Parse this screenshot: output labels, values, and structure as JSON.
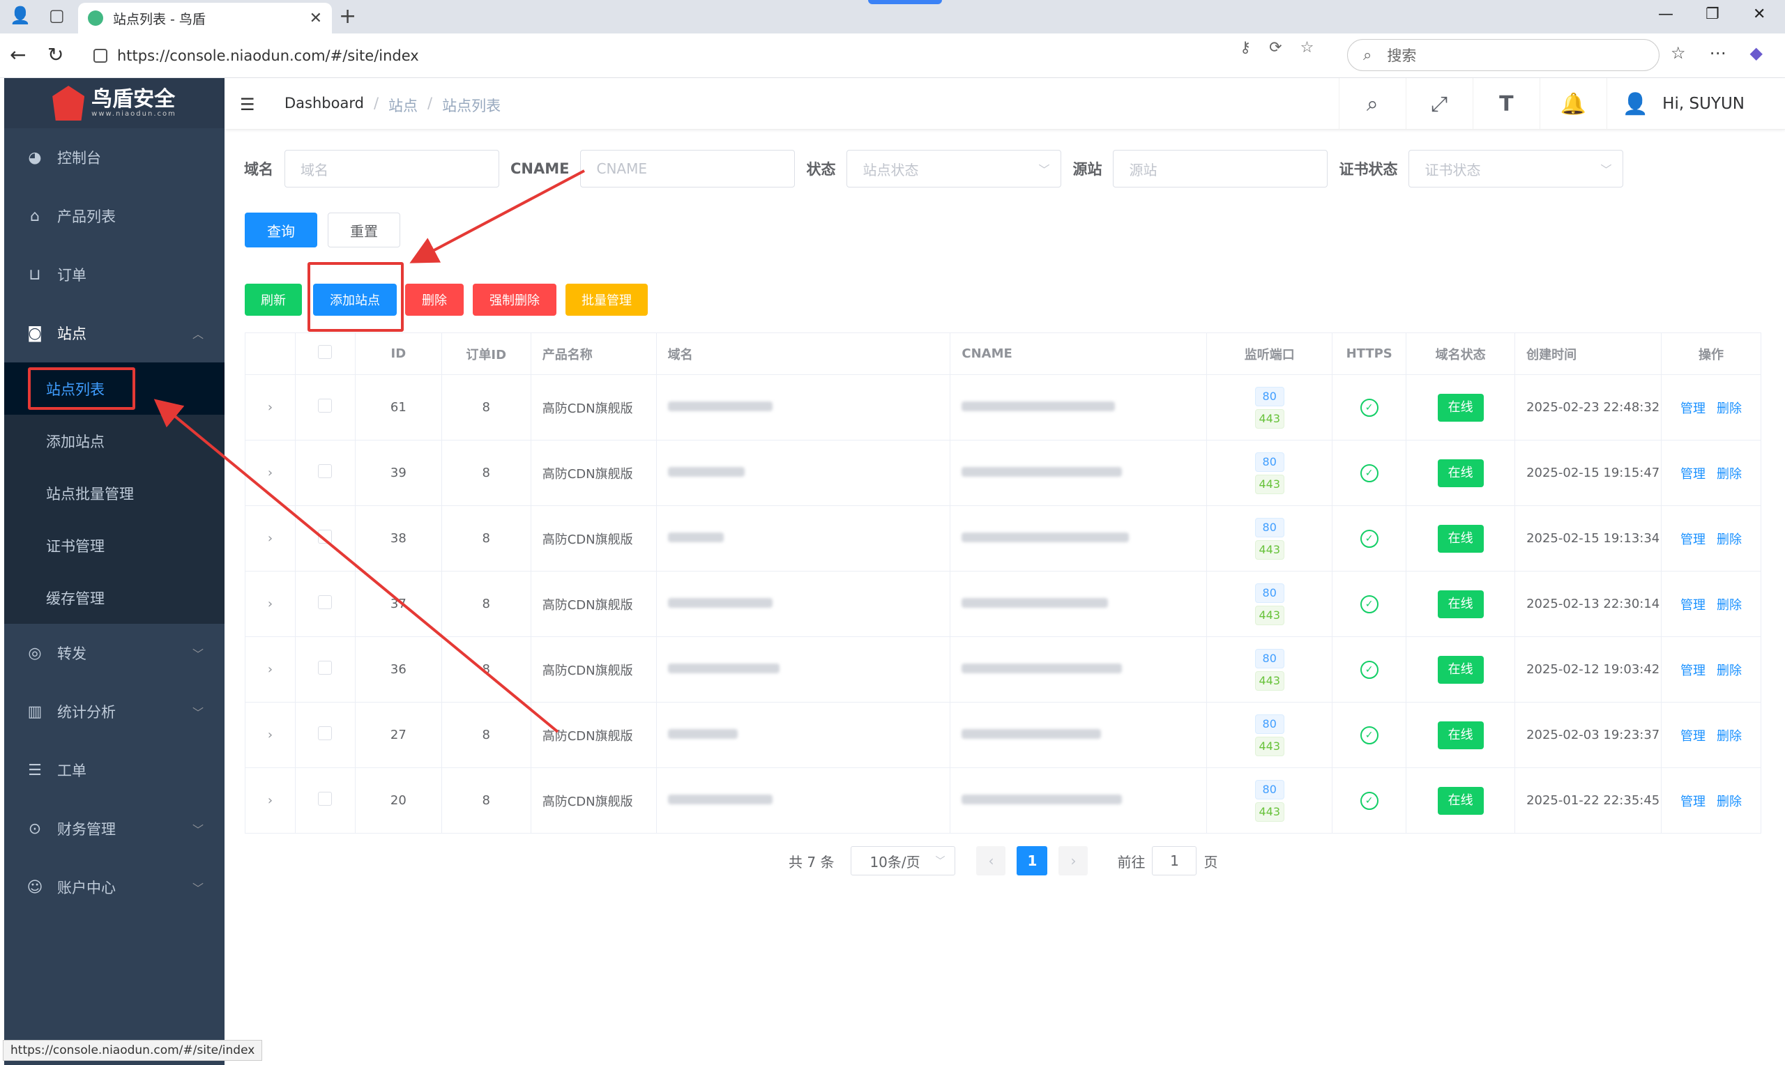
{
  "browser": {
    "tab_title": "站点列表 - 鸟盾",
    "url": "https://console.niaodun.com/#/site/index",
    "search_placeholder": "搜索",
    "status_url": "https://console.niaodun.com/#/site/index"
  },
  "brand": {
    "name": "鸟盾安全",
    "sub": "www.niaodun.com"
  },
  "sidebar": {
    "items": [
      {
        "label": "控制台",
        "icon": "dashboard-icon"
      },
      {
        "label": "产品列表",
        "icon": "shop-icon"
      },
      {
        "label": "订单",
        "icon": "cart-icon"
      },
      {
        "label": "站点",
        "icon": "site-icon"
      },
      {
        "label": "转发",
        "icon": "forward-icon"
      },
      {
        "label": "统计分析",
        "icon": "chart-icon"
      },
      {
        "label": "工单",
        "icon": "ticket-icon"
      },
      {
        "label": "财务管理",
        "icon": "finance-icon"
      },
      {
        "label": "账户中心",
        "icon": "user-icon"
      }
    ],
    "site_sub": [
      "站点列表",
      "添加站点",
      "站点批量管理",
      "证书管理",
      "缓存管理"
    ]
  },
  "breadcrumb": {
    "home": "Dashboard",
    "level1": "站点",
    "level2": "站点列表"
  },
  "user": {
    "greeting": "Hi, SUYUN"
  },
  "filters": {
    "domain_label": "域名",
    "domain_placeholder": "域名",
    "cname_label": "CNAME",
    "cname_placeholder": "CNAME",
    "status_label": "状态",
    "status_placeholder": "站点状态",
    "origin_label": "源站",
    "origin_placeholder": "源站",
    "cert_label": "证书状态",
    "cert_placeholder": "证书状态"
  },
  "buttons": {
    "query": "查询",
    "reset": "重置",
    "refresh": "刷新",
    "add_site": "添加站点",
    "delete": "删除",
    "force_delete": "强制删除",
    "batch": "批量管理"
  },
  "table": {
    "headers": [
      "ID",
      "订单ID",
      "产品名称",
      "域名",
      "CNAME",
      "监听端口",
      "HTTPS",
      "域名状态",
      "创建时间",
      "操作"
    ],
    "rows": [
      {
        "id": "61",
        "order": "8",
        "product": "高防CDN旗舰版",
        "port1": "80",
        "port2": "443",
        "status": "在线",
        "created": "2025-02-23 22:48:32"
      },
      {
        "id": "39",
        "order": "8",
        "product": "高防CDN旗舰版",
        "port1": "80",
        "port2": "443",
        "status": "在线",
        "created": "2025-02-15 19:15:47"
      },
      {
        "id": "38",
        "order": "8",
        "product": "高防CDN旗舰版",
        "port1": "80",
        "port2": "443",
        "status": "在线",
        "created": "2025-02-15 19:13:34"
      },
      {
        "id": "37",
        "order": "8",
        "product": "高防CDN旗舰版",
        "port1": "80",
        "port2": "443",
        "status": "在线",
        "created": "2025-02-13 22:30:14"
      },
      {
        "id": "36",
        "order": "8",
        "product": "高防CDN旗舰版",
        "port1": "80",
        "port2": "443",
        "status": "在线",
        "created": "2025-02-12 19:03:42"
      },
      {
        "id": "27",
        "order": "8",
        "product": "高防CDN旗舰版",
        "port1": "80",
        "port2": "443",
        "status": "在线",
        "created": "2025-02-03 19:23:37"
      },
      {
        "id": "20",
        "order": "8",
        "product": "高防CDN旗舰版",
        "port1": "80",
        "port2": "443",
        "status": "在线",
        "created": "2025-01-22 22:35:45"
      }
    ],
    "op_manage": "管理",
    "op_delete": "删除"
  },
  "pagination": {
    "total": "共 7 条",
    "page_size": "10条/页",
    "current": "1",
    "goto_label": "前往",
    "goto_value": "1",
    "page_unit": "页"
  },
  "colors": {
    "primary": "#1890ff",
    "success": "#13ce66",
    "danger": "#ff4949",
    "warning": "#ffba00",
    "sidebar": "#304156",
    "annotation": "#e53935"
  }
}
